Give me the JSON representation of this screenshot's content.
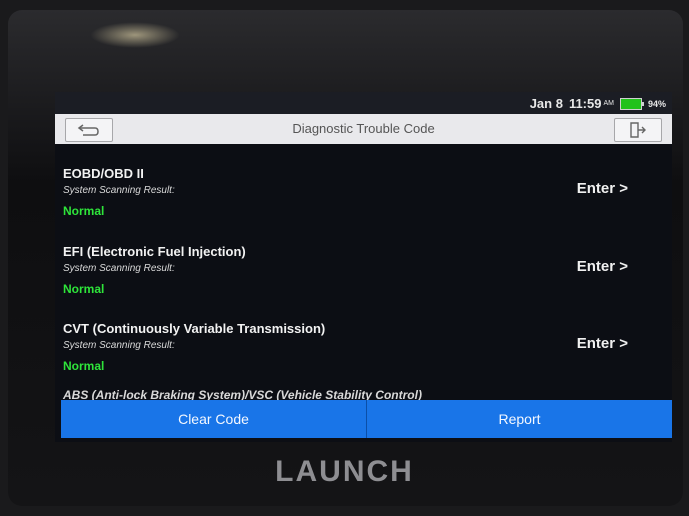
{
  "status_bar": {
    "date": "Jan 8",
    "time": "11:59",
    "ampm": "AM",
    "battery_percent": "94%",
    "battery_level": 0.94
  },
  "header": {
    "title": "Diagnostic Trouble Code",
    "back_icon": "back-arrow-icon",
    "exit_icon": "exit-icon"
  },
  "systems": [
    {
      "name": "EOBD/OBD II",
      "result_label": "System Scanning Result:",
      "result": "Normal",
      "enter_label": "Enter >"
    },
    {
      "name": "EFI (Electronic Fuel Injection)",
      "result_label": "System Scanning Result:",
      "result": "Normal",
      "enter_label": "Enter >"
    },
    {
      "name": "CVT (Continuously Variable Transmission)",
      "result_label": "System Scanning Result:",
      "result": "Normal",
      "enter_label": "Enter >"
    }
  ],
  "partial_row": "ABS (Anti-lock Braking System)/VSC (Vehicle Stability Control)",
  "actions": {
    "clear_code": "Clear Code",
    "report": "Report"
  },
  "device": {
    "brand": "LAUNCH"
  },
  "colors": {
    "status_normal": "#2ee43a",
    "action_bar": "#1975e8",
    "battery": "#21c21a"
  }
}
